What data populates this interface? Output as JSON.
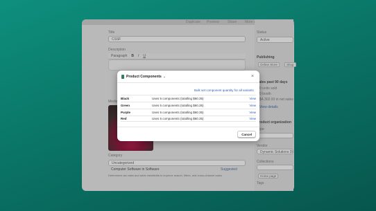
{
  "background_window": {
    "top_links": [
      "Duplicate",
      "Preview",
      "Share",
      "More actions"
    ],
    "title_label": "Title",
    "title_value": "CSSF",
    "description_label": "Description",
    "toolbar": {
      "paragraph": "Paragraph",
      "bold": "B",
      "italic": "I",
      "underline": "U"
    },
    "media_label": "Media",
    "category_label": "Category",
    "category_value": "Uncategorized",
    "category_suggestion": "Computer Software in Software",
    "suggestion_tag": "Suggested",
    "category_help": "Determines tax rates and adds metafields to improve search, filters, and cross-channel sales",
    "status_label": "Status",
    "status_value": "Active",
    "publishing_label": "Publishing",
    "sales_channels": [
      "Online Store",
      "Shop"
    ],
    "sales_label": "Sales past 90 days",
    "sales_lines": [
      "0 units sold",
      "0 booth",
      "$4,302.00 in net sales"
    ],
    "view_details": "View details",
    "product_org_label": "Product organization",
    "type_label": "Type",
    "vendor_label": "Vendor",
    "vendor_value": "Dynamic Solutions Drive",
    "collections_label": "Collections",
    "collection_tag": "Home page",
    "tags_label": "Tags"
  },
  "modal": {
    "title": "Product Components",
    "bulk_link": "Bulk set component quantity for all variants",
    "rows": [
      {
        "variant": "Black",
        "description": "Uses 5 components (totalling $60.35)",
        "action": "View"
      },
      {
        "variant": "Green",
        "description": "Uses 5 components (totalling $60.35)",
        "action": "View"
      },
      {
        "variant": "Purple",
        "description": "Uses 5 components (totalling $60.35)",
        "action": "View"
      },
      {
        "variant": "Red",
        "description": "Uses 5 components (totalling $60.35)",
        "action": "View"
      }
    ],
    "cancel_label": "Cancel"
  },
  "colors": {
    "backdrop": "#0a7567",
    "link": "#2c5fb8",
    "app_icon": "#2e7d5b"
  }
}
